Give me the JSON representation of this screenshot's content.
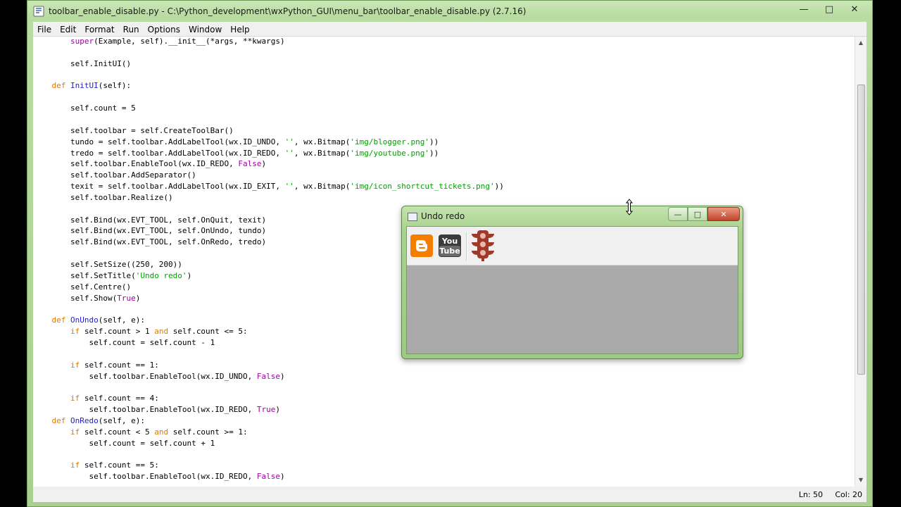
{
  "idle": {
    "title": "toolbar_enable_disable.py - C:\\Python_development\\wxPython_GUI\\menu_bar\\toolbar_enable_disable.py (2.7.16)",
    "icon": "python-idle-icon",
    "menu": [
      "File",
      "Edit",
      "Format",
      "Run",
      "Options",
      "Window",
      "Help"
    ],
    "status": {
      "ln": "Ln: 50",
      "col": "Col: 20"
    }
  },
  "code_lines": [
    [
      [
        "",
        "        "
      ],
      [
        "bi",
        "super"
      ],
      [
        "",
        "(Example, self).__init__(*args, **kwargs)"
      ]
    ],
    [],
    [
      [
        "",
        "        self.InitUI()"
      ]
    ],
    [],
    [
      [
        "",
        "    "
      ],
      [
        "kw",
        "def"
      ],
      [
        "",
        " "
      ],
      [
        "fn",
        "InitUI"
      ],
      [
        "",
        "(self):"
      ]
    ],
    [],
    [
      [
        "",
        "        self.count = 5"
      ]
    ],
    [],
    [
      [
        "",
        "        self.toolbar = self.CreateToolBar()"
      ]
    ],
    [
      [
        "",
        "        tundo = self.toolbar.AddLabelTool(wx.ID_UNDO, "
      ],
      [
        "str",
        "''"
      ],
      [
        "",
        ", wx.Bitmap("
      ],
      [
        "str",
        "'img/blogger.png'"
      ],
      [
        "",
        "))"
      ]
    ],
    [
      [
        "",
        "        tredo = self.toolbar.AddLabelTool(wx.ID_REDO, "
      ],
      [
        "str",
        "''"
      ],
      [
        "",
        ", wx.Bitmap("
      ],
      [
        "str",
        "'img/youtube.png'"
      ],
      [
        "",
        "))"
      ]
    ],
    [
      [
        "",
        "        self.toolbar.EnableTool(wx.ID_REDO, "
      ],
      [
        "bi",
        "False"
      ],
      [
        "",
        ")"
      ]
    ],
    [
      [
        "",
        "        self.toolbar.AddSeparator()"
      ]
    ],
    [
      [
        "",
        "        texit = self.toolbar.AddLabelTool(wx.ID_EXIT, "
      ],
      [
        "str",
        "''"
      ],
      [
        "",
        ", wx.Bitmap("
      ],
      [
        "str",
        "'img/icon_shortcut_tickets.png'"
      ],
      [
        "",
        "))"
      ]
    ],
    [
      [
        "",
        "        self.toolbar.Realize()"
      ]
    ],
    [],
    [
      [
        "",
        "        self.Bind(wx.EVT_TOOL, self.OnQuit, texit)"
      ]
    ],
    [
      [
        "",
        "        self.Bind(wx.EVT_TOOL, self.OnUndo, tundo)"
      ]
    ],
    [
      [
        "",
        "        self.Bind(wx.EVT_TOOL, self.OnRedo, tredo)"
      ]
    ],
    [],
    [
      [
        "",
        "        self.SetSize((250, 200))"
      ]
    ],
    [
      [
        "",
        "        self.SetTitle("
      ],
      [
        "str",
        "'Undo redo'"
      ],
      [
        "",
        ")"
      ]
    ],
    [
      [
        "",
        "        self.Centre()"
      ]
    ],
    [
      [
        "",
        "        self.Show("
      ],
      [
        "bi",
        "True"
      ],
      [
        "",
        ")"
      ]
    ],
    [],
    [
      [
        "",
        "    "
      ],
      [
        "kw",
        "def"
      ],
      [
        "",
        " "
      ],
      [
        "fn",
        "OnUndo"
      ],
      [
        "",
        "(self, e):"
      ]
    ],
    [
      [
        "",
        "        "
      ],
      [
        "kw",
        "if"
      ],
      [
        "",
        " self.count > 1 "
      ],
      [
        "kw",
        "and"
      ],
      [
        "",
        " self.count <= 5:"
      ]
    ],
    [
      [
        "",
        "            self.count = self.count - 1"
      ]
    ],
    [],
    [
      [
        "",
        "        "
      ],
      [
        "kw",
        "if"
      ],
      [
        "",
        " self.count == 1:"
      ]
    ],
    [
      [
        "",
        "            self.toolbar.EnableTool(wx.ID_UNDO, "
      ],
      [
        "bi",
        "False"
      ],
      [
        "",
        ")"
      ]
    ],
    [],
    [
      [
        "",
        "        "
      ],
      [
        "kw",
        "if"
      ],
      [
        "",
        " self.count == 4:"
      ]
    ],
    [
      [
        "",
        "            self.toolbar.EnableTool(wx.ID_REDO, "
      ],
      [
        "bi",
        "True"
      ],
      [
        "",
        ")"
      ]
    ],
    [
      [
        "",
        "    "
      ],
      [
        "kw",
        "def"
      ],
      [
        "",
        " "
      ],
      [
        "fn",
        "OnRedo"
      ],
      [
        "",
        "(self, e):"
      ]
    ],
    [
      [
        "",
        "        "
      ],
      [
        "kw",
        "if"
      ],
      [
        "",
        " self.count < 5 "
      ],
      [
        "kw",
        "and"
      ],
      [
        "",
        " self.count >= 1:"
      ]
    ],
    [
      [
        "",
        "            self.count = self.count + 1"
      ]
    ],
    [],
    [
      [
        "",
        "        "
      ],
      [
        "kw",
        "if"
      ],
      [
        "",
        " self.count == 5:"
      ]
    ],
    [
      [
        "",
        "            self.toolbar.EnableTool(wx.ID_REDO, "
      ],
      [
        "bi",
        "False"
      ],
      [
        "",
        ")"
      ]
    ]
  ],
  "frame": {
    "title": "Undo redo",
    "tools": [
      {
        "icon": "blogger-icon",
        "enabled": true
      },
      {
        "icon": "youtube-icon",
        "enabled": false,
        "label": "You Tube"
      },
      {
        "icon": "traffic-light-icon",
        "enabled": true
      }
    ]
  },
  "colors": {
    "keyword": "#e07a00",
    "function": "#1f1fcc",
    "string": "#00a000",
    "builtin": "#a000a0",
    "frame_accent": "#9dca82"
  }
}
